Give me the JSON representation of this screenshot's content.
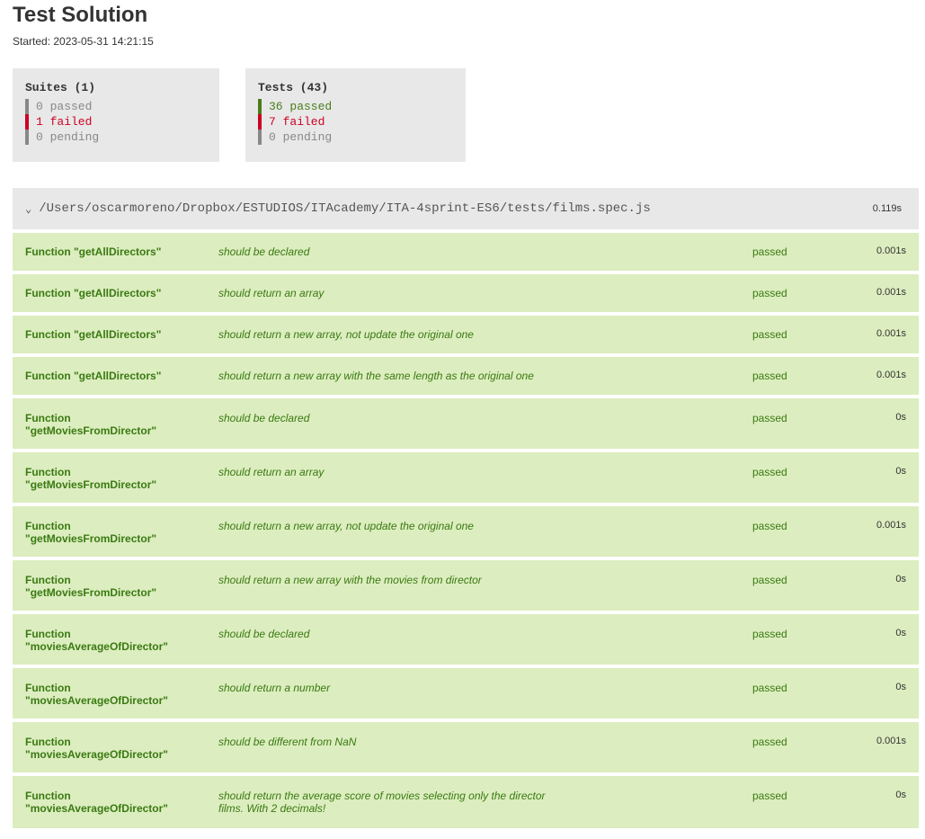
{
  "header": {
    "title": "Test Solution",
    "started": "Started: 2023-05-31 14:21:15"
  },
  "summary": {
    "suites": {
      "title": "Suites (1)",
      "passed": "0 passed",
      "failed": "1 failed",
      "pending": "0 pending"
    },
    "tests": {
      "title": "Tests (43)",
      "passed": "36 passed",
      "failed": "7 failed",
      "pending": "0 pending"
    }
  },
  "colors": {
    "passed": "#4a7d1a",
    "failed": "#cc0022",
    "neutral": "#888888",
    "row_passed_bg": "#dcedbf"
  },
  "suite": {
    "chevron_icon": "chevron-down-icon",
    "path": "/Users/oscarmoreno/Dropbox/ESTUDIOS/ITAcademy/ITA-4sprint-ES6/tests/films.spec.js",
    "time": "0.119s"
  },
  "tests": [
    {
      "suite": "Function \"getAllDirectors\"",
      "spec": "should be declared",
      "status": "passed",
      "time": "0.001s"
    },
    {
      "suite": "Function \"getAllDirectors\"",
      "spec": "should return an array",
      "status": "passed",
      "time": "0.001s"
    },
    {
      "suite": "Function \"getAllDirectors\"",
      "spec": "should return a new array, not update the original one",
      "status": "passed",
      "time": "0.001s"
    },
    {
      "suite": "Function \"getAllDirectors\"",
      "spec": "should return a new array with the same length as the original one",
      "status": "passed",
      "time": "0.001s"
    },
    {
      "suite": "Function \"getMoviesFromDirector\"",
      "spec": "should be declared",
      "status": "passed",
      "time": "0s"
    },
    {
      "suite": "Function \"getMoviesFromDirector\"",
      "spec": "should return an array",
      "status": "passed",
      "time": "0s"
    },
    {
      "suite": "Function \"getMoviesFromDirector\"",
      "spec": "should return a new array, not update the original one",
      "status": "passed",
      "time": "0.001s"
    },
    {
      "suite": "Function \"getMoviesFromDirector\"",
      "spec": "should return a new array with the movies from director",
      "status": "passed",
      "time": "0s"
    },
    {
      "suite": "Function \"moviesAverageOfDirector\"",
      "spec": "should be declared",
      "status": "passed",
      "time": "0s"
    },
    {
      "suite": "Function \"moviesAverageOfDirector\"",
      "spec": "should return a number",
      "status": "passed",
      "time": "0s"
    },
    {
      "suite": "Function \"moviesAverageOfDirector\"",
      "spec": "should be different from NaN",
      "status": "passed",
      "time": "0.001s"
    },
    {
      "suite": "Function \"moviesAverageOfDirector\"",
      "spec": "should return the average score of movies selecting only the director films. With 2 decimals!",
      "status": "passed",
      "time": "0s"
    }
  ]
}
